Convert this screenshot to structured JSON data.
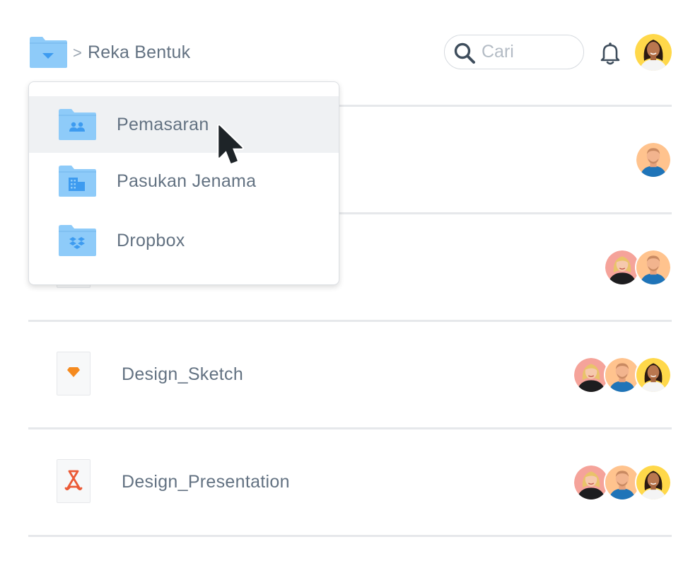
{
  "header": {
    "breadcrumb_separator": ">",
    "folder_title": "Reka Bentuk",
    "search_placeholder": "Cari",
    "search_icon": "search-icon",
    "notification_icon": "bell-icon"
  },
  "dropdown": {
    "items": [
      {
        "label": "Pemasaran",
        "icon": "team-folder-icon",
        "selected": true
      },
      {
        "label": "Pasukan Jenama",
        "icon": "building-folder-icon",
        "selected": false
      },
      {
        "label": "Dropbox",
        "icon": "dropbox-folder-icon",
        "selected": false
      }
    ]
  },
  "files": [
    {
      "name": "",
      "members": [
        "man-avatar"
      ]
    },
    {
      "name": "",
      "members": [
        "woman-blonde-avatar",
        "man-avatar"
      ]
    },
    {
      "name": "Design_Sketch",
      "icon": "sketch-icon",
      "members": [
        "woman-blonde-avatar",
        "man-avatar",
        "woman-dark-avatar"
      ]
    },
    {
      "name": "Design_Presentation",
      "icon": "pdf-icon",
      "members": [
        "woman-blonde-avatar",
        "man-avatar",
        "woman-dark-avatar"
      ]
    }
  ],
  "colors": {
    "folder_blue": "#8ecbf9",
    "folder_glyph": "#3d9bf0",
    "sketch_orange": "#f58a1f",
    "pdf_red": "#eb5a36",
    "avatar_yellow": "#ffd84a",
    "avatar_peach": "#ffc38e",
    "avatar_pink": "#f5a39a"
  }
}
